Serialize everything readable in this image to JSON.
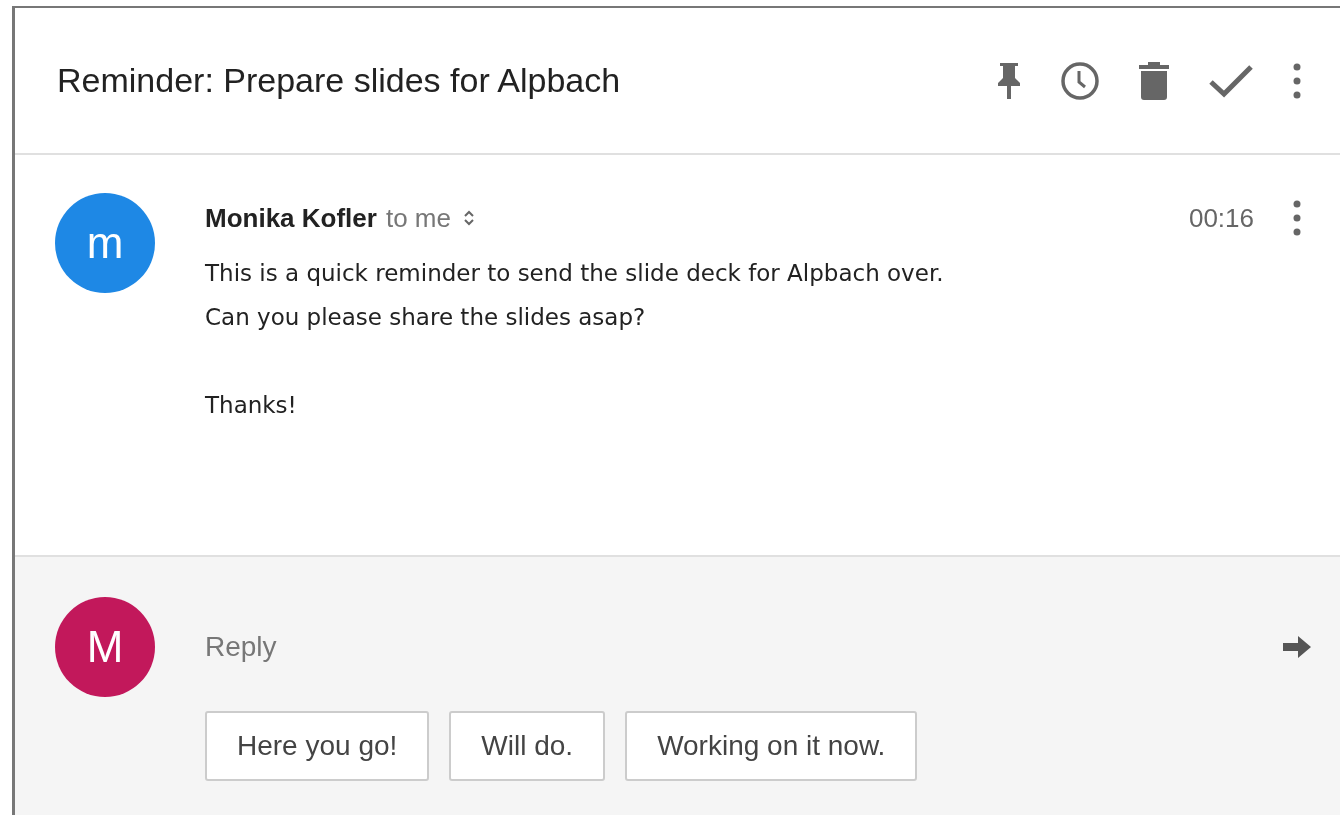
{
  "subject": "Reminder: Prepare slides for Alpbach",
  "message": {
    "avatar_initial": "m",
    "color": "#1e88e5",
    "sender": "Monika Kofler",
    "recipient": "to me",
    "time": "00:16",
    "body": [
      "This is a quick reminder to send the slide deck for Alpbach over.",
      "Can you please share the slides asap?"
    ],
    "signoff": "Thanks!"
  },
  "reply": {
    "avatar_initial": "M",
    "color": "#c2185b",
    "placeholder": "Reply",
    "suggestions": [
      "Here you go!",
      "Will do.",
      "Working on it now."
    ]
  }
}
